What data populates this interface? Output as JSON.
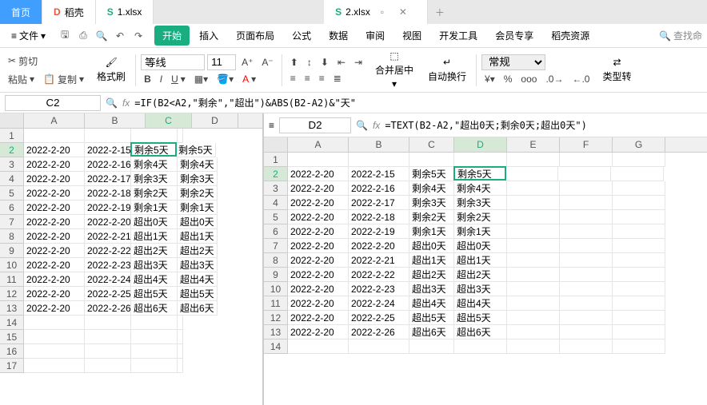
{
  "tabs": {
    "home": "首页",
    "docer": "稻壳",
    "file1": "1.xlsx",
    "file2": "2.xlsx"
  },
  "menu": {
    "file": "文件",
    "ribbon": [
      "开始",
      "插入",
      "页面布局",
      "公式",
      "数据",
      "审阅",
      "视图",
      "开发工具",
      "会员专享",
      "稻壳资源"
    ],
    "search": "查找命"
  },
  "ribbon": {
    "cut": "剪切",
    "paste": "粘贴",
    "copy": "复制",
    "format_painter": "格式刷",
    "font": "等线",
    "size": "11",
    "merge": "合并居中",
    "wrap": "自动换行",
    "num_format": "常规",
    "type_conv": "类型转"
  },
  "left": {
    "name": "C2",
    "formula": "=IF(B2<A2,\"剩余\",\"超出\")&ABS(B2-A2)&\"天\"",
    "cols": [
      "A",
      "B",
      "C",
      "D"
    ],
    "rows": [
      {
        "n": "1",
        "a": "",
        "b": "",
        "c": "",
        "d": ""
      },
      {
        "n": "2",
        "a": "2022-2-20",
        "b": "2022-2-15",
        "c": "剩余5天",
        "d": "剩余5天"
      },
      {
        "n": "3",
        "a": "2022-2-20",
        "b": "2022-2-16",
        "c": "剩余4天",
        "d": "剩余4天"
      },
      {
        "n": "4",
        "a": "2022-2-20",
        "b": "2022-2-17",
        "c": "剩余3天",
        "d": "剩余3天"
      },
      {
        "n": "5",
        "a": "2022-2-20",
        "b": "2022-2-18",
        "c": "剩余2天",
        "d": "剩余2天"
      },
      {
        "n": "6",
        "a": "2022-2-20",
        "b": "2022-2-19",
        "c": "剩余1天",
        "d": "剩余1天"
      },
      {
        "n": "7",
        "a": "2022-2-20",
        "b": "2022-2-20",
        "c": "超出0天",
        "d": "超出0天"
      },
      {
        "n": "8",
        "a": "2022-2-20",
        "b": "2022-2-21",
        "c": "超出1天",
        "d": "超出1天"
      },
      {
        "n": "9",
        "a": "2022-2-20",
        "b": "2022-2-22",
        "c": "超出2天",
        "d": "超出2天"
      },
      {
        "n": "10",
        "a": "2022-2-20",
        "b": "2022-2-23",
        "c": "超出3天",
        "d": "超出3天"
      },
      {
        "n": "11",
        "a": "2022-2-20",
        "b": "2022-2-24",
        "c": "超出4天",
        "d": "超出4天"
      },
      {
        "n": "12",
        "a": "2022-2-20",
        "b": "2022-2-25",
        "c": "超出5天",
        "d": "超出5天"
      },
      {
        "n": "13",
        "a": "2022-2-20",
        "b": "2022-2-26",
        "c": "超出6天",
        "d": "超出6天"
      },
      {
        "n": "14",
        "a": "",
        "b": "",
        "c": "",
        "d": ""
      },
      {
        "n": "15",
        "a": "",
        "b": "",
        "c": "",
        "d": ""
      },
      {
        "n": "16",
        "a": "",
        "b": "",
        "c": "",
        "d": ""
      },
      {
        "n": "17",
        "a": "",
        "b": "",
        "c": "",
        "d": ""
      }
    ]
  },
  "right": {
    "name": "D2",
    "formula": "=TEXT(B2-A2,\"超出0天;剩余0天;超出0天\")",
    "cols": [
      "A",
      "B",
      "C",
      "D",
      "E",
      "F",
      "G"
    ],
    "rows": [
      {
        "n": "1",
        "a": "",
        "b": "",
        "c": "",
        "d": ""
      },
      {
        "n": "2",
        "a": "2022-2-20",
        "b": "2022-2-15",
        "c": "剩余5天",
        "d": "剩余5天"
      },
      {
        "n": "3",
        "a": "2022-2-20",
        "b": "2022-2-16",
        "c": "剩余4天",
        "d": "剩余4天"
      },
      {
        "n": "4",
        "a": "2022-2-20",
        "b": "2022-2-17",
        "c": "剩余3天",
        "d": "剩余3天"
      },
      {
        "n": "5",
        "a": "2022-2-20",
        "b": "2022-2-18",
        "c": "剩余2天",
        "d": "剩余2天"
      },
      {
        "n": "6",
        "a": "2022-2-20",
        "b": "2022-2-19",
        "c": "剩余1天",
        "d": "剩余1天"
      },
      {
        "n": "7",
        "a": "2022-2-20",
        "b": "2022-2-20",
        "c": "超出0天",
        "d": "超出0天"
      },
      {
        "n": "8",
        "a": "2022-2-20",
        "b": "2022-2-21",
        "c": "超出1天",
        "d": "超出1天"
      },
      {
        "n": "9",
        "a": "2022-2-20",
        "b": "2022-2-22",
        "c": "超出2天",
        "d": "超出2天"
      },
      {
        "n": "10",
        "a": "2022-2-20",
        "b": "2022-2-23",
        "c": "超出3天",
        "d": "超出3天"
      },
      {
        "n": "11",
        "a": "2022-2-20",
        "b": "2022-2-24",
        "c": "超出4天",
        "d": "超出4天"
      },
      {
        "n": "12",
        "a": "2022-2-20",
        "b": "2022-2-25",
        "c": "超出5天",
        "d": "超出5天"
      },
      {
        "n": "13",
        "a": "2022-2-20",
        "b": "2022-2-26",
        "c": "超出6天",
        "d": "超出6天"
      },
      {
        "n": "14",
        "a": "",
        "b": "",
        "c": "",
        "d": ""
      }
    ]
  }
}
